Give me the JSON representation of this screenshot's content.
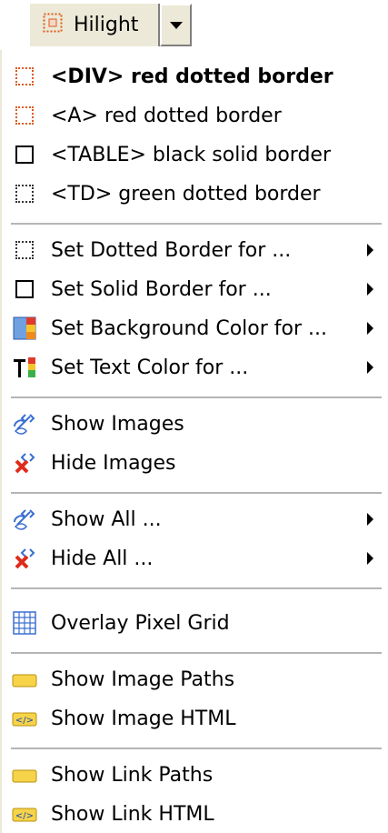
{
  "toolbar": {
    "label": "Hilight",
    "icon": "dotted-square-icon"
  },
  "menu": {
    "items": [
      {
        "label": "<DIV> red dotted border",
        "bold": true
      },
      {
        "label": "<A> red dotted border"
      },
      {
        "label": "<TABLE> black solid border"
      },
      {
        "label": "<TD> green dotted border"
      },
      {
        "label": "Set Dotted Border for ...",
        "submenu": true
      },
      {
        "label": "Set Solid Border for ...",
        "submenu": true
      },
      {
        "label": "Set Background Color for ...",
        "submenu": true
      },
      {
        "label": "Set Text Color for ...",
        "submenu": true
      },
      {
        "label": "Show Images"
      },
      {
        "label": "Hide Images"
      },
      {
        "label": "Show All ...",
        "submenu": true
      },
      {
        "label": "Hide All ...",
        "submenu": true
      },
      {
        "label": "Overlay Pixel Grid"
      },
      {
        "label": "Show Image Paths"
      },
      {
        "label": "Show Image HTML"
      },
      {
        "label": "Show Link Paths"
      },
      {
        "label": "Show Link HTML"
      }
    ]
  },
  "colors": {
    "red_dotted": "#e05a1a",
    "toolbar_bg": "#ece9d8",
    "separator": "#b5b5b5"
  }
}
